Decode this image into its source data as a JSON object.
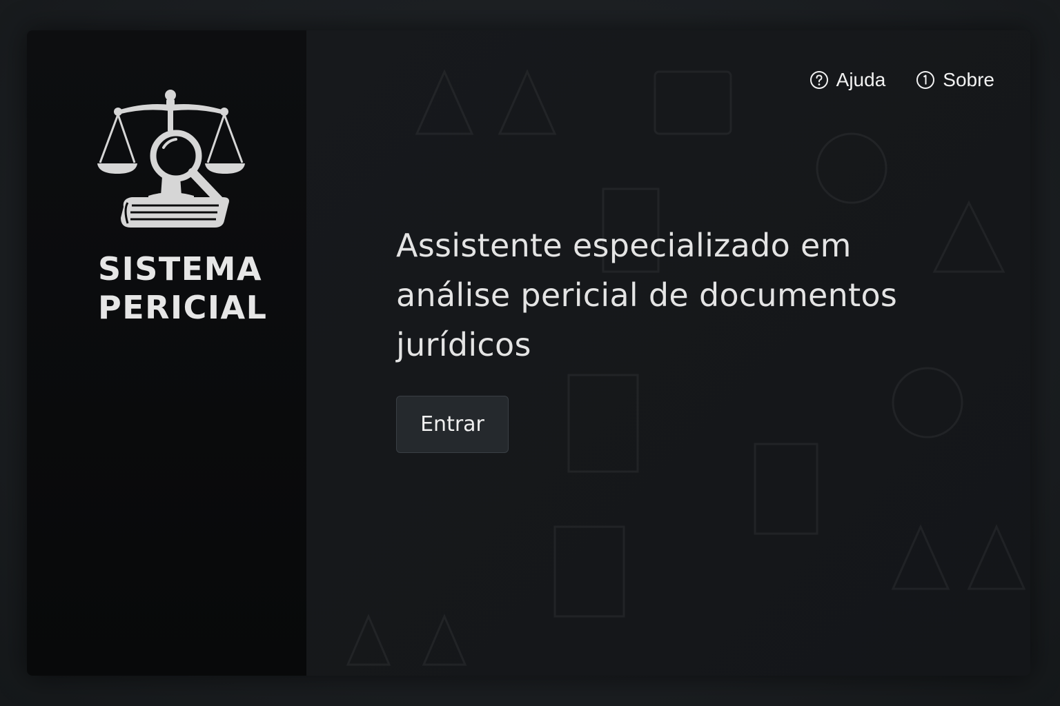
{
  "brand": {
    "line1": "SISTEMA",
    "line2": "PERICIAL",
    "logo_icon": "scales-magnifier-book-icon"
  },
  "nav": {
    "items": [
      {
        "label": "Ajuda",
        "icon": "help-circle-icon"
      },
      {
        "label": "Sobre",
        "icon": "info-circle-icon"
      }
    ]
  },
  "hero": {
    "headline": "Assistente especializado em análise pericial de documentos jurídicos",
    "cta_label": "Entrar"
  },
  "colors": {
    "background": "#1b1e21",
    "sidebar": "#0a0b0c",
    "main": "#15181b",
    "text": "#e4e4e4",
    "button": "#25292d"
  }
}
